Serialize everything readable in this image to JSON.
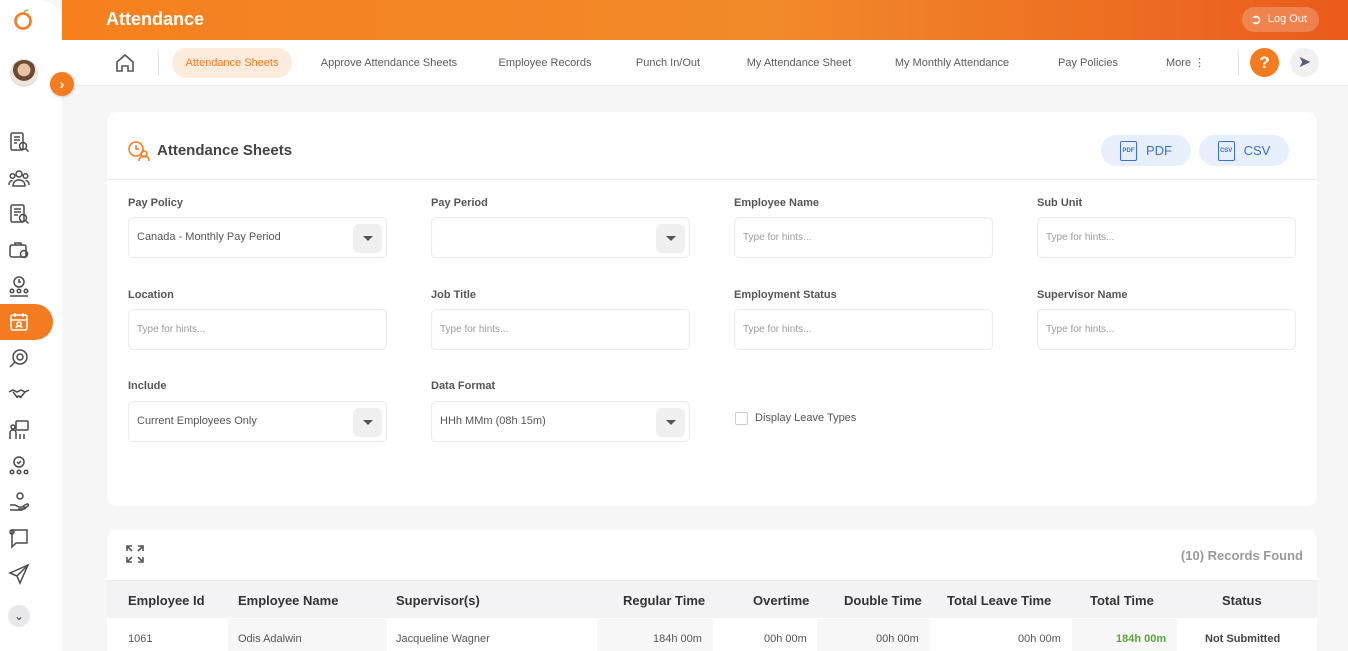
{
  "header": {
    "app_title": "Attendance",
    "logout_label": "Log Out"
  },
  "tabs": [
    {
      "label": "Attendance Sheets",
      "active": true
    },
    {
      "label": "Approve Attendance Sheets"
    },
    {
      "label": "Employee Records"
    },
    {
      "label": "Punch In/Out"
    },
    {
      "label": "My Attendance Sheet"
    },
    {
      "label": "My Monthly Attendance"
    },
    {
      "label": "Pay Policies"
    }
  ],
  "more_label": "More",
  "help_label": "?",
  "card": {
    "title": "Attendance Sheets",
    "pdf_label": "PDF",
    "csv_label": "CSV",
    "pdf_icon_text": "PDF",
    "csv_icon_text": "CSV"
  },
  "filters": {
    "pay_policy": {
      "label": "Pay Policy",
      "value": "Canada - Monthly Pay Period"
    },
    "pay_period": {
      "label": "Pay Period",
      "value": ""
    },
    "employee_name": {
      "label": "Employee Name",
      "placeholder": "Type for hints..."
    },
    "sub_unit": {
      "label": "Sub Unit",
      "placeholder": "Type for hints..."
    },
    "location": {
      "label": "Location",
      "placeholder": "Type for hints..."
    },
    "job_title": {
      "label": "Job Title",
      "placeholder": "Type for hints..."
    },
    "employment_status": {
      "label": "Employment Status",
      "placeholder": "Type for hints..."
    },
    "supervisor_name": {
      "label": "Supervisor Name",
      "placeholder": "Type for hints..."
    },
    "include": {
      "label": "Include",
      "value": "Current Employees Only"
    },
    "data_format": {
      "label": "Data Format",
      "value": "HHh MMm (08h 15m)"
    },
    "display_leave_types": {
      "label": "Display Leave Types",
      "checked": false
    }
  },
  "records": {
    "found_label": "(10) Records Found",
    "columns": [
      "Employee Id",
      "Employee Name",
      "Supervisor(s)",
      "Regular Time",
      "Overtime",
      "Double Time",
      "Total Leave Time",
      "Total Time",
      "Status"
    ],
    "rows": [
      [
        "1061",
        "Odis Adalwin",
        "Jacqueline Wagner",
        "184h 00m",
        "00h 00m",
        "00h 00m",
        "00h 00m",
        "184h 00m",
        "Not Submitted"
      ]
    ]
  },
  "colors": {
    "accent": "#f47b20",
    "total_time": "#5aa53c"
  }
}
